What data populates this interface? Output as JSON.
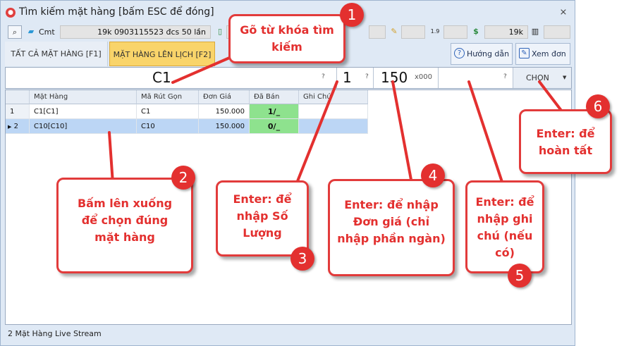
{
  "window": {
    "title": "Tìm kiếm mặt hàng [bấm ESC để đóng]",
    "close": "⨯"
  },
  "toolbar": {
    "cmt_label": "Cmt",
    "info_field": "19k  0903115523 đcs  50 lần",
    "amount_field": "19k",
    "counter_label": "1.9"
  },
  "tabs": [
    {
      "label": "TẤT CẢ MẶT HÀNG [F1]"
    },
    {
      "label": "MẶT HÀNG LÊN LỊCH [F2]"
    }
  ],
  "side_buttons": {
    "help": "Hướng dẫn",
    "view_order": "Xem đơn"
  },
  "input_row": {
    "search_value": "C1",
    "quantity": "1",
    "price": "150",
    "price_unit": "x000",
    "note": "",
    "q": "?",
    "choose": "CHỌN"
  },
  "grid": {
    "columns": [
      "Mặt Hàng",
      "Mã Rút Gọn",
      "Đơn Giá",
      "Đã Bán",
      "Ghi Chú"
    ],
    "rows": [
      {
        "idx": "1",
        "item": "C1[C1]",
        "code": "C1",
        "price": "150.000",
        "sold": "1/_"
      },
      {
        "idx": "2",
        "item": "C10[C10]",
        "code": "C10",
        "price": "150.000",
        "sold": "0/_"
      }
    ]
  },
  "status": {
    "text": "2 Mặt Hàng Live Stream"
  },
  "callouts": [
    {
      "num": "1",
      "text": "Gõ từ khóa tìm kiếm"
    },
    {
      "num": "2",
      "text": "Bấm lên xuống để chọn đúng mặt hàng"
    },
    {
      "num": "3",
      "text": "Enter: để nhập Số Lượng"
    },
    {
      "num": "4",
      "text": "Enter: để nhập Đơn giá (chỉ nhập phần ngàn)"
    },
    {
      "num": "5",
      "text": "Enter: để nhập ghi chú (nếu có)"
    },
    {
      "num": "6",
      "text": "Enter: để hoàn tất"
    }
  ],
  "colors": {
    "accent_red": "#e3302f",
    "tab_active": "#f9d46a",
    "sold_green": "#8ee28e",
    "selected_row": "#bcd6f5"
  }
}
